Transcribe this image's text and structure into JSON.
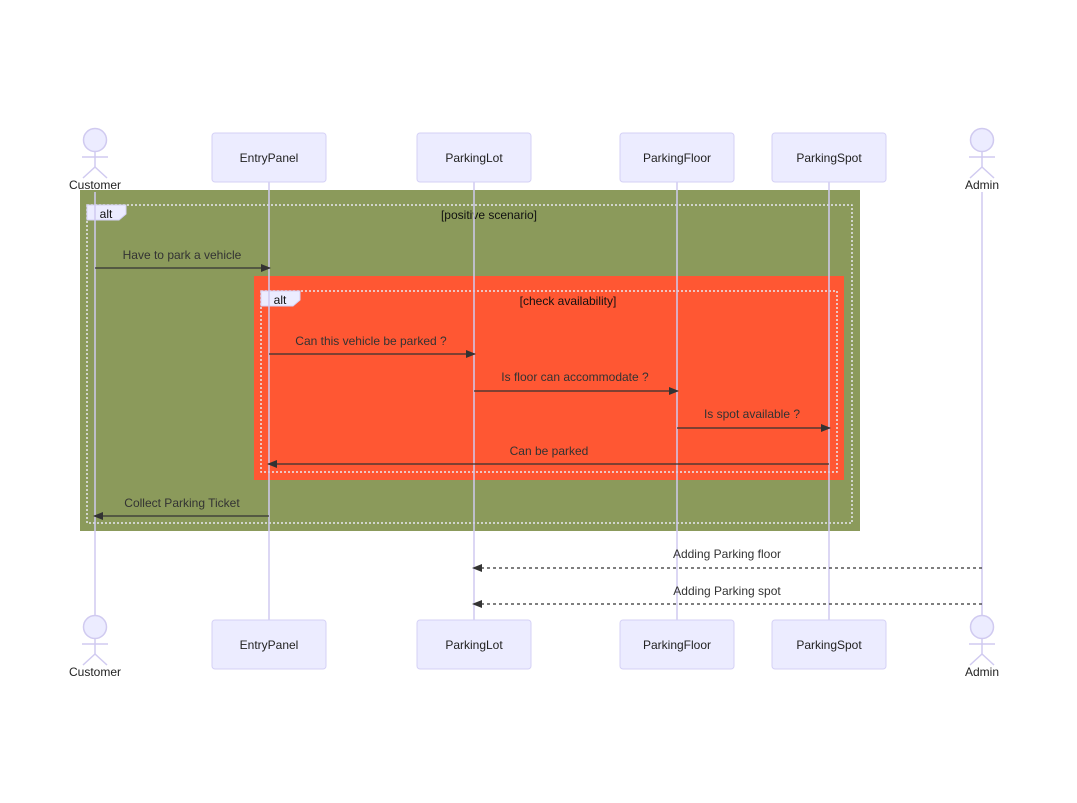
{
  "diagram": {
    "type": "sequence",
    "participants": [
      {
        "id": "customer",
        "label": "Customer",
        "kind": "actor"
      },
      {
        "id": "entrypanel",
        "label": "EntryPanel",
        "kind": "participant"
      },
      {
        "id": "parkinglot",
        "label": "ParkingLot",
        "kind": "participant"
      },
      {
        "id": "parkingfloor",
        "label": "ParkingFloor",
        "kind": "participant"
      },
      {
        "id": "parkingspot",
        "label": "ParkingSpot",
        "kind": "participant"
      },
      {
        "id": "admin",
        "label": "Admin",
        "kind": "actor"
      }
    ],
    "fragments": [
      {
        "id": "outer",
        "type_label": "alt",
        "condition": "[positive scenario]",
        "color": "#8B9A5B"
      },
      {
        "id": "inner",
        "type_label": "alt",
        "condition": "[check availability]",
        "color": "#FF5733"
      }
    ],
    "messages": [
      {
        "from": "customer",
        "to": "entrypanel",
        "text": "Have to park a vehicle",
        "style": "solid"
      },
      {
        "from": "entrypanel",
        "to": "parkinglot",
        "text": "Can this vehicle be parked ?",
        "style": "solid"
      },
      {
        "from": "parkinglot",
        "to": "parkingfloor",
        "text": "Is floor can accommodate ?",
        "style": "solid"
      },
      {
        "from": "parkingfloor",
        "to": "parkingspot",
        "text": "Is spot available ?",
        "style": "solid"
      },
      {
        "from": "parkingspot",
        "to": "entrypanel",
        "text": "Can be parked",
        "style": "solid"
      },
      {
        "from": "entrypanel",
        "to": "customer",
        "text": "Collect Parking Ticket",
        "style": "solid"
      },
      {
        "from": "admin",
        "to": "parkinglot",
        "text": "Adding Parking floor",
        "style": "dashed"
      },
      {
        "from": "admin",
        "to": "parkinglot",
        "text": "Adding Parking spot",
        "style": "dashed"
      }
    ]
  }
}
